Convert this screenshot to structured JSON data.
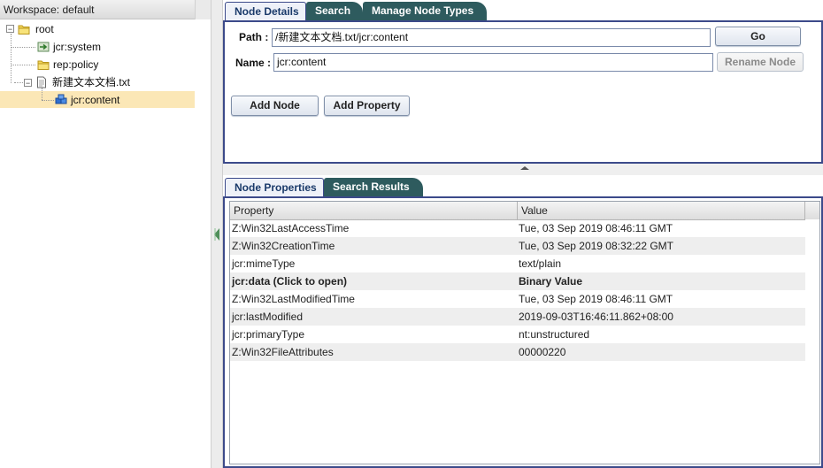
{
  "workspace": {
    "label": "Workspace: default"
  },
  "tree": {
    "root": {
      "label": "root",
      "toggle": "−"
    },
    "items": [
      {
        "label": "jcr:system",
        "icon": "system-node-icon"
      },
      {
        "label": "rep:policy",
        "icon": "folder-icon"
      },
      {
        "label": "新建文本文档.txt",
        "icon": "file-icon",
        "toggle": "−"
      },
      {
        "label": "jcr:content",
        "icon": "content-node-icon",
        "selected": true
      }
    ]
  },
  "top_tabs": [
    "Node Details",
    "Search",
    "Manage Node Types"
  ],
  "details": {
    "path_label": "Path :",
    "path_value": "/新建文本文档.txt/jcr:content",
    "go_label": "Go",
    "name_label": "Name :",
    "name_value": "jcr:content",
    "rename_label": "Rename Node",
    "add_node_label": "Add Node",
    "add_property_label": "Add Property"
  },
  "bottom_tabs": [
    "Node Properties",
    "Search Results"
  ],
  "properties": {
    "columns": [
      "Property",
      "Value"
    ],
    "rows": [
      {
        "property": "Z:Win32LastAccessTime",
        "value": "Tue, 03 Sep 2019 08:46:11 GMT"
      },
      {
        "property": "Z:Win32CreationTime",
        "value": "Tue, 03 Sep 2019 08:32:22 GMT"
      },
      {
        "property": "jcr:mimeType",
        "value": "text/plain"
      },
      {
        "property": "jcr:data (Click to open)",
        "value": "Binary Value"
      },
      {
        "property": "Z:Win32LastModifiedTime",
        "value": "Tue, 03 Sep 2019 08:46:11 GMT"
      },
      {
        "property": "jcr:lastModified",
        "value": "2019-09-03T16:46:11.862+08:00"
      },
      {
        "property": "jcr:primaryType",
        "value": "nt:unstructured"
      },
      {
        "property": "Z:Win32FileAttributes",
        "value": "00000220"
      }
    ]
  },
  "colors": {
    "accent_border": "#3c4a8a",
    "tab_inactive": "#2e5b5e",
    "selection": "#fbe7b6"
  }
}
